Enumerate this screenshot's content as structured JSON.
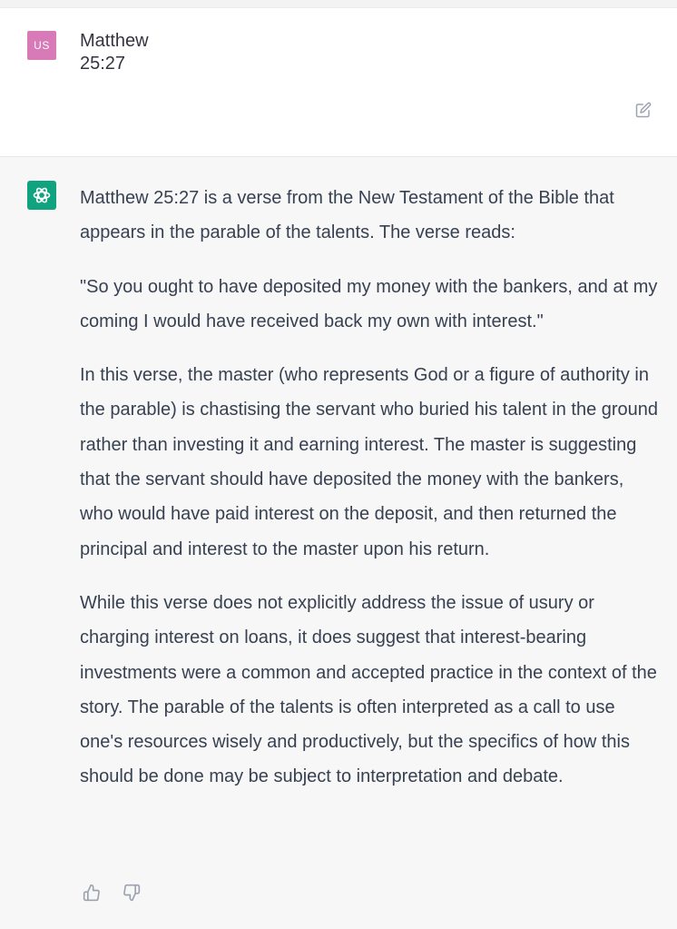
{
  "conversation": {
    "user": {
      "avatar_initials": "US",
      "avatar_color": "#d97ab8",
      "message": "Matthew 25:27"
    },
    "assistant": {
      "avatar_color": "#10a37f",
      "paragraphs": [
        "Matthew 25:27 is a verse from the New Testament of the Bible that appears in the parable of the talents. The verse reads:",
        "\"So you ought to have deposited my money with the bankers, and at my coming I would have received back my own with interest.\"",
        "In this verse, the master (who represents God or a figure of authority in the parable) is chastising the servant who buried his talent in the ground rather than investing it and earning interest. The master is suggesting that the servant should have deposited the money with the bankers, who would have paid interest on the deposit, and then returned the principal and interest to the master upon his return.",
        "While this verse does not explicitly address the issue of usury or charging interest on loans, it does suggest that interest-bearing investments were a common and accepted practice in the context of the story. The parable of the talents is often interpreted as a call to use one's resources wisely and productively, but the specifics of how this should be done may be subject to interpretation and debate."
      ]
    }
  },
  "icons": {
    "edit": "edit-icon",
    "assistant_logo": "openai-logo-icon",
    "thumbs_up": "thumbs-up-icon",
    "thumbs_down": "thumbs-down-icon"
  }
}
